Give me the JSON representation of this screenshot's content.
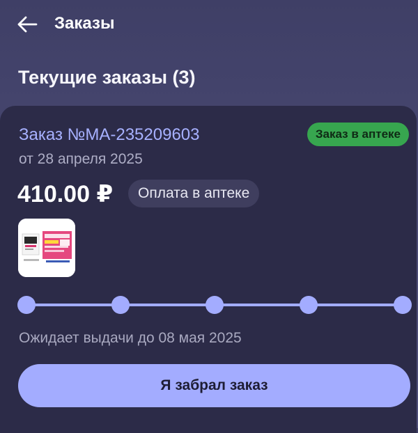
{
  "header": {
    "title": "Заказы",
    "back_icon": "arrow-left-icon"
  },
  "section": {
    "title": "Текущие заказы (3)"
  },
  "order": {
    "number": "Заказ №MA-235209603",
    "date": "от 28 апреля 2025",
    "status": "Заказ в аптеке",
    "price": "410.00 ₽",
    "payment": "Оплата в аптеке",
    "product_image": "pregnancy-test-package-image",
    "progress": {
      "steps_total": 5,
      "steps_completed": 5
    },
    "pickup_note": "Ожидает выдачи до 08 мая 2025",
    "action_label": "Я забрал заказ"
  },
  "colors": {
    "accent": "#a3acff",
    "status_green": "#37a64f",
    "card_bg": "#2c2b48",
    "page_bg": "#45446e"
  }
}
